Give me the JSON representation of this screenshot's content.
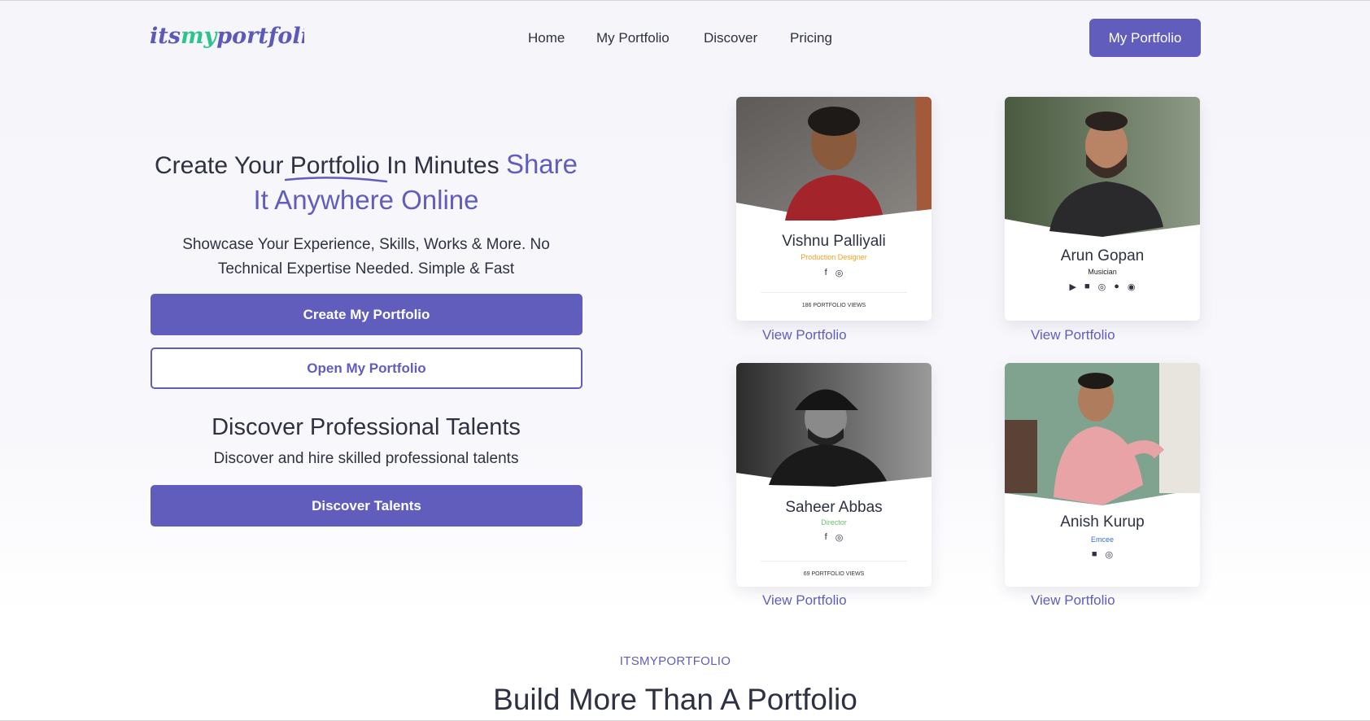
{
  "logo": {
    "text_prefix": "its",
    "text_mid": "my",
    "text_suffix": "portfolio"
  },
  "nav": {
    "home": "Home",
    "my_portfolio": "My Portfolio",
    "discover": "Discover",
    "pricing": "Pricing"
  },
  "header_button": "My Portfolio",
  "hero": {
    "title_part1": "Create Your ",
    "title_part2": "Portfolio",
    "title_part3": " In Minutes ",
    "title_accent": "Share It Anywhere Online",
    "subtitle": "Showcase Your Experience, Skills, Works & More. No Technical Expertise Needed. Simple & Fast",
    "create_button": "Create My Portfolio",
    "open_button": "Open My Portfolio"
  },
  "discover": {
    "title": "Discover Professional Talents",
    "subtitle": "Discover and hire skilled professional talents",
    "button": "Discover Talents"
  },
  "profiles": [
    {
      "name": "Vishnu Palliyali",
      "role": "Production Designer",
      "role_color": "#f0a020",
      "socials": [
        "facebook-icon",
        "instagram-icon"
      ],
      "views": "186 PORTFOLIO VIEWS",
      "link": "View Portfolio"
    },
    {
      "name": "Arun Gopan",
      "role": "Musician",
      "role_color": "#222222",
      "socials": [
        "youtube-icon",
        "facebook-icon",
        "instagram-icon",
        "apple-icon",
        "spotify-icon"
      ],
      "views": "",
      "link": "View Portfolio"
    },
    {
      "name": "Saheer Abbas",
      "role": "Director",
      "role_color": "#6cc070",
      "socials": [
        "facebook-icon",
        "instagram-icon"
      ],
      "views": "69 PORTFOLIO VIEWS",
      "link": "View Portfolio"
    },
    {
      "name": "Anish Kurup",
      "role": "Emcee",
      "role_color": "#3b6fd8",
      "socials": [
        "facebook-icon",
        "instagram-icon"
      ],
      "views": "",
      "link": "View Portfolio"
    }
  ],
  "bottom": {
    "eyebrow": "ITSMYPORTFOLIO",
    "title": "Build More Than A Portfolio"
  },
  "colors": {
    "accent": "#615dbd",
    "text": "#2d3142",
    "logo_green": "#2bc48a"
  }
}
